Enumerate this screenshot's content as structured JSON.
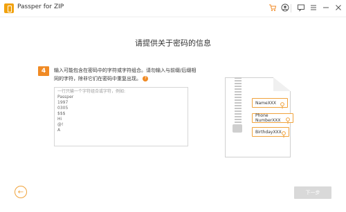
{
  "app": {
    "title": "Passper for ZIP"
  },
  "page": {
    "heading": "请提供关于密码的信息",
    "step_number": "4",
    "instruction": "输入可能包含在密码中的字符或字符组合。请勿输入与前缀/后缀相同的字符，除非它们在密码中重复出现。",
    "help_glyph": "?",
    "textarea": {
      "placeholder": "一行只输一个字符组合或字符，例如:",
      "lines": [
        "Passper",
        "1997",
        "0305",
        "$$$",
        "Hi",
        "@!",
        "A"
      ]
    },
    "illustration_tags": [
      "NameXXX",
      "Phone NumberXXX",
      "BirthdayXXX"
    ],
    "next_label": "下一步",
    "back_glyph": "←"
  },
  "colors": {
    "accent": "#f08a24",
    "tag_border": "#f0a23a",
    "disabled": "#d9d9d9"
  },
  "icons": [
    "cart-icon",
    "account-icon",
    "feedback-icon",
    "menu-icon",
    "minimize-icon",
    "close-icon",
    "key-icon",
    "back-arrow-icon",
    "help-icon"
  ]
}
